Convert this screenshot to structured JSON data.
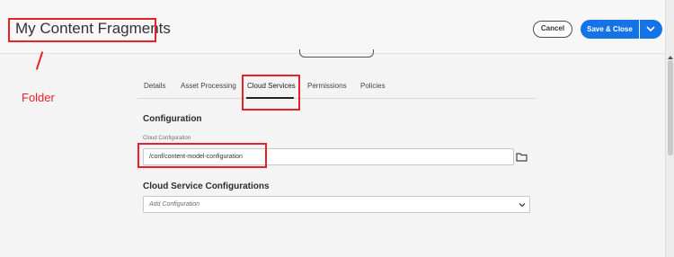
{
  "header": {
    "title": "My Content Fragments",
    "cancel_label": "Cancel",
    "save_label": "Save & Close"
  },
  "annotation": {
    "folder_label": "Folder",
    "color": "#e8202a"
  },
  "tabs": [
    {
      "label": "Details",
      "active": false
    },
    {
      "label": "Asset Processing",
      "active": false
    },
    {
      "label": "Cloud Services",
      "active": true
    },
    {
      "label": "Permissions",
      "active": false
    },
    {
      "label": "Policies",
      "active": false
    }
  ],
  "configuration": {
    "heading": "Configuration",
    "field_label": "Cloud Configuration",
    "field_value": "/conf/content-model-configuration"
  },
  "cloud_service_configurations": {
    "heading": "Cloud Service Configurations",
    "placeholder": "Add Configuration"
  },
  "colors": {
    "accent": "#1473e6",
    "annotation": "#e8202a"
  },
  "icons": {
    "browse": "folder-icon",
    "dropdown": "chevron-down-icon"
  }
}
